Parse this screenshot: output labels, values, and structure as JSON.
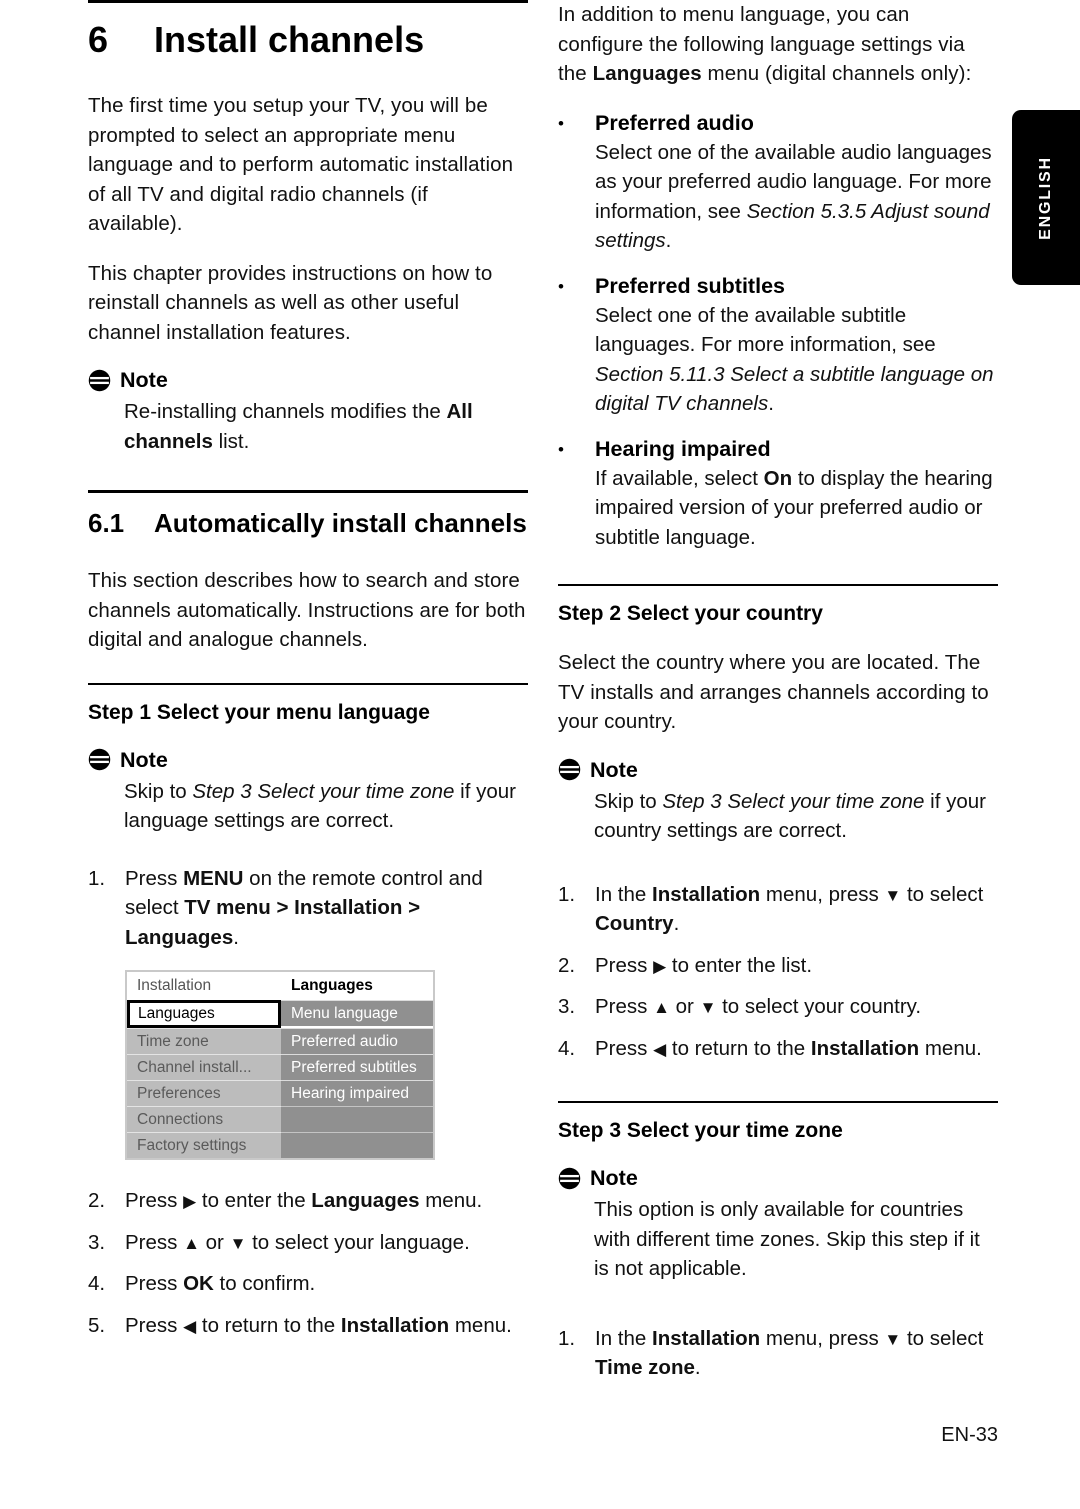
{
  "page": {
    "footer": "EN-33",
    "side_tab": "ENGLISH",
    "accent_black": "#000000",
    "menu_left_bg": "#bcbcbc",
    "menu_right_bg": "#909090"
  },
  "left_column": {
    "chapter": {
      "number": "6",
      "title": "Install channels"
    },
    "intro_paragraph_1": "The first time you setup your TV, you will be prompted to select an appropriate menu language and to perform automatic installation of all TV and digital radio channels (if available).",
    "intro_paragraph_2": "This chapter provides instructions on how to reinstall channels as well as other useful channel installation features.",
    "note_1": {
      "label": "Note",
      "body_part_1": "Re-installing channels modifies the ",
      "body_bold_1": "All channels",
      "body_part_2": " list."
    },
    "section": {
      "number": "6.1",
      "title": "Automatically install channels"
    },
    "section_paragraph": "This section describes how to search and store channels automatically. Instructions are for both digital and analogue channels.",
    "step1": {
      "heading": "Step 1 Select your menu language",
      "note": {
        "label": "Note",
        "body_part_1": "Skip to ",
        "body_italic": "Step 3 Select your time zone",
        "body_part_2": " if your language settings are correct."
      },
      "items": [
        {
          "marker": "1.",
          "segments": [
            {
              "text": "Press ",
              "style": "normal"
            },
            {
              "text": "MENU",
              "style": "bold"
            },
            {
              "text": " on the remote control and select ",
              "style": "normal"
            },
            {
              "text": "TV menu > Installation > Languages",
              "style": "bold"
            },
            {
              "text": ".",
              "style": "normal"
            }
          ]
        },
        {
          "marker": "2.",
          "segments": [
            {
              "text": "Press ",
              "style": "normal"
            },
            {
              "text": "▶",
              "style": "arrow"
            },
            {
              "text": " to enter the ",
              "style": "normal"
            },
            {
              "text": "Languages",
              "style": "bold"
            },
            {
              "text": " menu.",
              "style": "normal"
            }
          ]
        },
        {
          "marker": "3.",
          "segments": [
            {
              "text": "Press ",
              "style": "normal"
            },
            {
              "text": "▲",
              "style": "arrow"
            },
            {
              "text": " or ",
              "style": "normal"
            },
            {
              "text": "▼",
              "style": "arrow"
            },
            {
              "text": " to select your language.",
              "style": "normal"
            }
          ]
        },
        {
          "marker": "4.",
          "segments": [
            {
              "text": "Press ",
              "style": "normal"
            },
            {
              "text": "OK",
              "style": "bold"
            },
            {
              "text": " to confirm.",
              "style": "normal"
            }
          ]
        },
        {
          "marker": "5.",
          "segments": [
            {
              "text": "Press ",
              "style": "normal"
            },
            {
              "text": "◀",
              "style": "arrow"
            },
            {
              "text": " to return to the ",
              "style": "normal"
            },
            {
              "text": "Installation",
              "style": "bold"
            },
            {
              "text": " menu.",
              "style": "normal"
            }
          ]
        }
      ]
    },
    "tv_menu_screenshot": {
      "header_left": "Installation",
      "header_right": "Languages",
      "left_items": [
        {
          "label": "Languages",
          "selected": true
        },
        {
          "label": "Time zone",
          "selected": false
        },
        {
          "label": "Channel install...",
          "selected": false
        },
        {
          "label": "Preferences",
          "selected": false
        },
        {
          "label": "Connections",
          "selected": false
        },
        {
          "label": "Factory settings",
          "selected": false
        }
      ],
      "right_items": [
        "Menu language",
        "Preferred audio",
        "Preferred subtitles",
        "Hearing impaired",
        "",
        ""
      ]
    }
  },
  "right_column": {
    "intro": {
      "part_1": "In addition to menu language, you can configure the following language settings via the ",
      "bold_1": "Languages",
      "part_2": " menu (digital channels only):"
    },
    "bullets": [
      {
        "bullet": "•",
        "heading": "Preferred audio",
        "segments": [
          {
            "text": "Select one of the available audio languages as your preferred audio language. For more information, see ",
            "style": "normal"
          },
          {
            "text": "Section 5.3.5 Adjust sound settings",
            "style": "italic"
          },
          {
            "text": ".",
            "style": "normal"
          }
        ]
      },
      {
        "bullet": "•",
        "heading": "Preferred subtitles",
        "segments": [
          {
            "text": "Select one of the available subtitle languages. For more information, see ",
            "style": "normal"
          },
          {
            "text": "Section 5.11.3 Select a subtitle language on digital TV channels",
            "style": "italic"
          },
          {
            "text": ".",
            "style": "normal"
          }
        ]
      },
      {
        "bullet": "•",
        "heading": "Hearing impaired",
        "segments": [
          {
            "text": "If available, select ",
            "style": "normal"
          },
          {
            "text": "On",
            "style": "bold"
          },
          {
            "text": " to display the hearing impaired version of your preferred audio or subtitle language.",
            "style": "normal"
          }
        ]
      }
    ],
    "step2": {
      "heading": "Step 2 Select your country",
      "paragraph": "Select the country where you are located. The TV installs and arranges channels according to your country.",
      "note": {
        "label": "Note",
        "body_part_1": "Skip to ",
        "body_italic": "Step 3 Select your time zone",
        "body_part_2": " if your country settings are correct."
      },
      "items": [
        {
          "marker": "1.",
          "segments": [
            {
              "text": "In the ",
              "style": "normal"
            },
            {
              "text": "Installation",
              "style": "bold"
            },
            {
              "text": " menu, press ",
              "style": "normal"
            },
            {
              "text": "▼",
              "style": "arrow"
            },
            {
              "text": " to select ",
              "style": "normal"
            },
            {
              "text": "Country",
              "style": "bold"
            },
            {
              "text": ".",
              "style": "normal"
            }
          ]
        },
        {
          "marker": "2.",
          "segments": [
            {
              "text": "Press ",
              "style": "normal"
            },
            {
              "text": "▶",
              "style": "arrow"
            },
            {
              "text": " to enter the list.",
              "style": "normal"
            }
          ]
        },
        {
          "marker": "3.",
          "segments": [
            {
              "text": "Press ",
              "style": "normal"
            },
            {
              "text": "▲",
              "style": "arrow"
            },
            {
              "text": " or ",
              "style": "normal"
            },
            {
              "text": "▼",
              "style": "arrow"
            },
            {
              "text": " to select your country.",
              "style": "normal"
            }
          ]
        },
        {
          "marker": "4.",
          "segments": [
            {
              "text": "Press ",
              "style": "normal"
            },
            {
              "text": "◀",
              "style": "arrow"
            },
            {
              "text": " to return to the ",
              "style": "normal"
            },
            {
              "text": "Installation",
              "style": "bold"
            },
            {
              "text": " menu.",
              "style": "normal"
            }
          ]
        }
      ]
    },
    "step3": {
      "heading": "Step 3 Select your time zone",
      "note": {
        "label": "Note",
        "body_part_1": "This option is only available for countries with different time zones. Skip this step if it is not applicable.",
        "body_italic": "",
        "body_part_2": ""
      },
      "items": [
        {
          "marker": "1.",
          "segments": [
            {
              "text": "In the ",
              "style": "normal"
            },
            {
              "text": "Installation",
              "style": "bold"
            },
            {
              "text": " menu, press ",
              "style": "normal"
            },
            {
              "text": "▼",
              "style": "arrow"
            },
            {
              "text": " to select ",
              "style": "normal"
            },
            {
              "text": "Time zone",
              "style": "bold"
            },
            {
              "text": ".",
              "style": "normal"
            }
          ]
        }
      ]
    }
  }
}
